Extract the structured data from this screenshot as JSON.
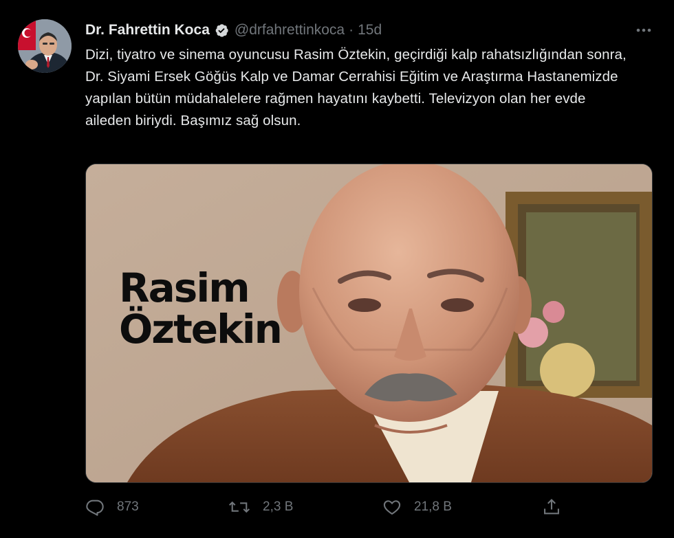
{
  "tweet": {
    "author_name": "Dr. Fahrettin Koca",
    "handle": "@drfahrettinkoca",
    "separator": "·",
    "time_ago": "15d",
    "text": "Dizi, tiyatro ve sinema oyuncusu Rasim Öztekin, geçirdiği kalp rahatsızlığından sonra, Dr. Siyami Ersek Göğüs Kalp ve Damar Cerrahisi Eğitim ve Araştırma Hastanemizde yapılan bütün müdahalelere rağmen hayatını kaybetti. Televizyon olan her evde aileden biriydi. Başımız sağ olsun.",
    "media": {
      "overlay_line1": "Rasim",
      "overlay_line2": "Öztekin"
    },
    "actions": {
      "reply_count": "873",
      "retweet_count": "2,3 B",
      "like_count": "21,8 B"
    }
  },
  "icons": [
    "verified-badge-icon",
    "more-options-icon",
    "reply-icon",
    "retweet-icon",
    "like-icon",
    "share-icon"
  ],
  "colors": {
    "background": "#000000",
    "text": "#e7e9ea",
    "secondary": "#71767b"
  }
}
